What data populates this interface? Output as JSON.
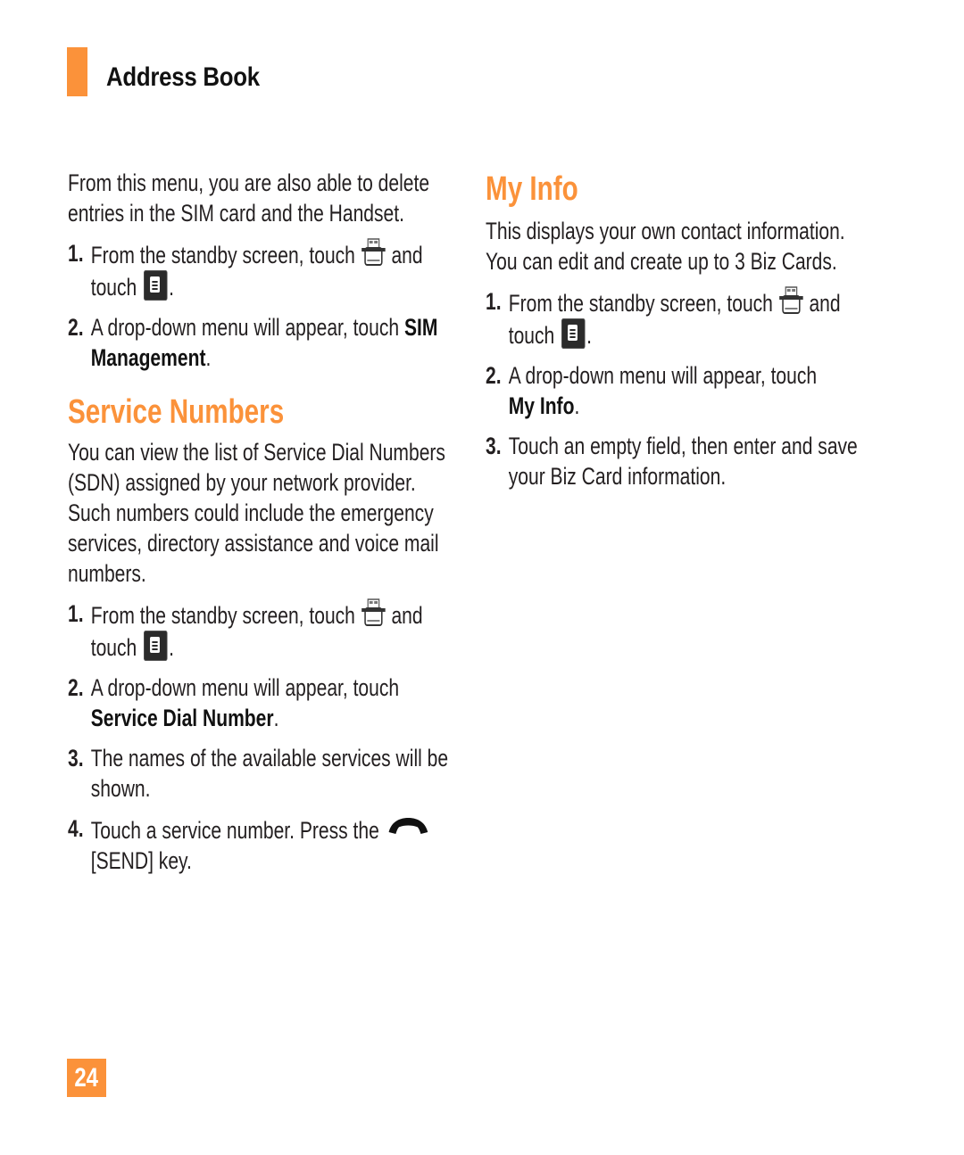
{
  "header": {
    "section_title": "Address Book",
    "accent_color": "#fb923a"
  },
  "intro": {
    "text": "From this menu, you are also able to delete entries in the SIM card and the Handset.",
    "steps": [
      {
        "num": "1.",
        "pre": "From the standby screen, touch",
        "icon1": "address-book-icon",
        "mid": "and",
        "touch": "touch",
        "icon2": "menu-icon",
        "post": "."
      },
      {
        "num": "2.",
        "pre": "A drop-down menu will appear, touch",
        "bold": "SIM Management",
        "post": "."
      }
    ]
  },
  "service_numbers": {
    "heading": "Service Numbers",
    "text": "You can view the list of Service Dial Numbers (SDN) assigned by your network provider. Such numbers could include the emergency services, directory assistance and voice mail numbers.",
    "steps": [
      {
        "num": "1.",
        "pre": "From the standby screen, touch",
        "icon1": "address-book-icon",
        "mid": "and",
        "touch": "touch",
        "icon2": "menu-icon",
        "post": "."
      },
      {
        "num": "2.",
        "pre": "A drop-down menu will appear, touch",
        "bold": "Service Dial Number",
        "post": "."
      },
      {
        "num": "3.",
        "text": "The names of the available services will be shown."
      },
      {
        "num": "4.",
        "pre": "Touch a service number. Press the",
        "icon": "send-phone-icon",
        "post": "[SEND] key."
      }
    ]
  },
  "my_info": {
    "heading": "My Info",
    "text": "This displays your own contact information. You can edit and create up to 3 Biz Cards.",
    "steps": [
      {
        "num": "1.",
        "pre": "From the standby screen, touch",
        "icon1": "address-book-icon",
        "mid": "and",
        "touch": "touch",
        "icon2": "menu-icon",
        "post": "."
      },
      {
        "num": "2.",
        "pre": "A drop-down menu will appear, touch",
        "bold": "My Info",
        "post": "."
      },
      {
        "num": "3.",
        "text": "Touch an empty field, then enter and save your Biz Card information."
      }
    ]
  },
  "footer": {
    "page_number": "24"
  }
}
